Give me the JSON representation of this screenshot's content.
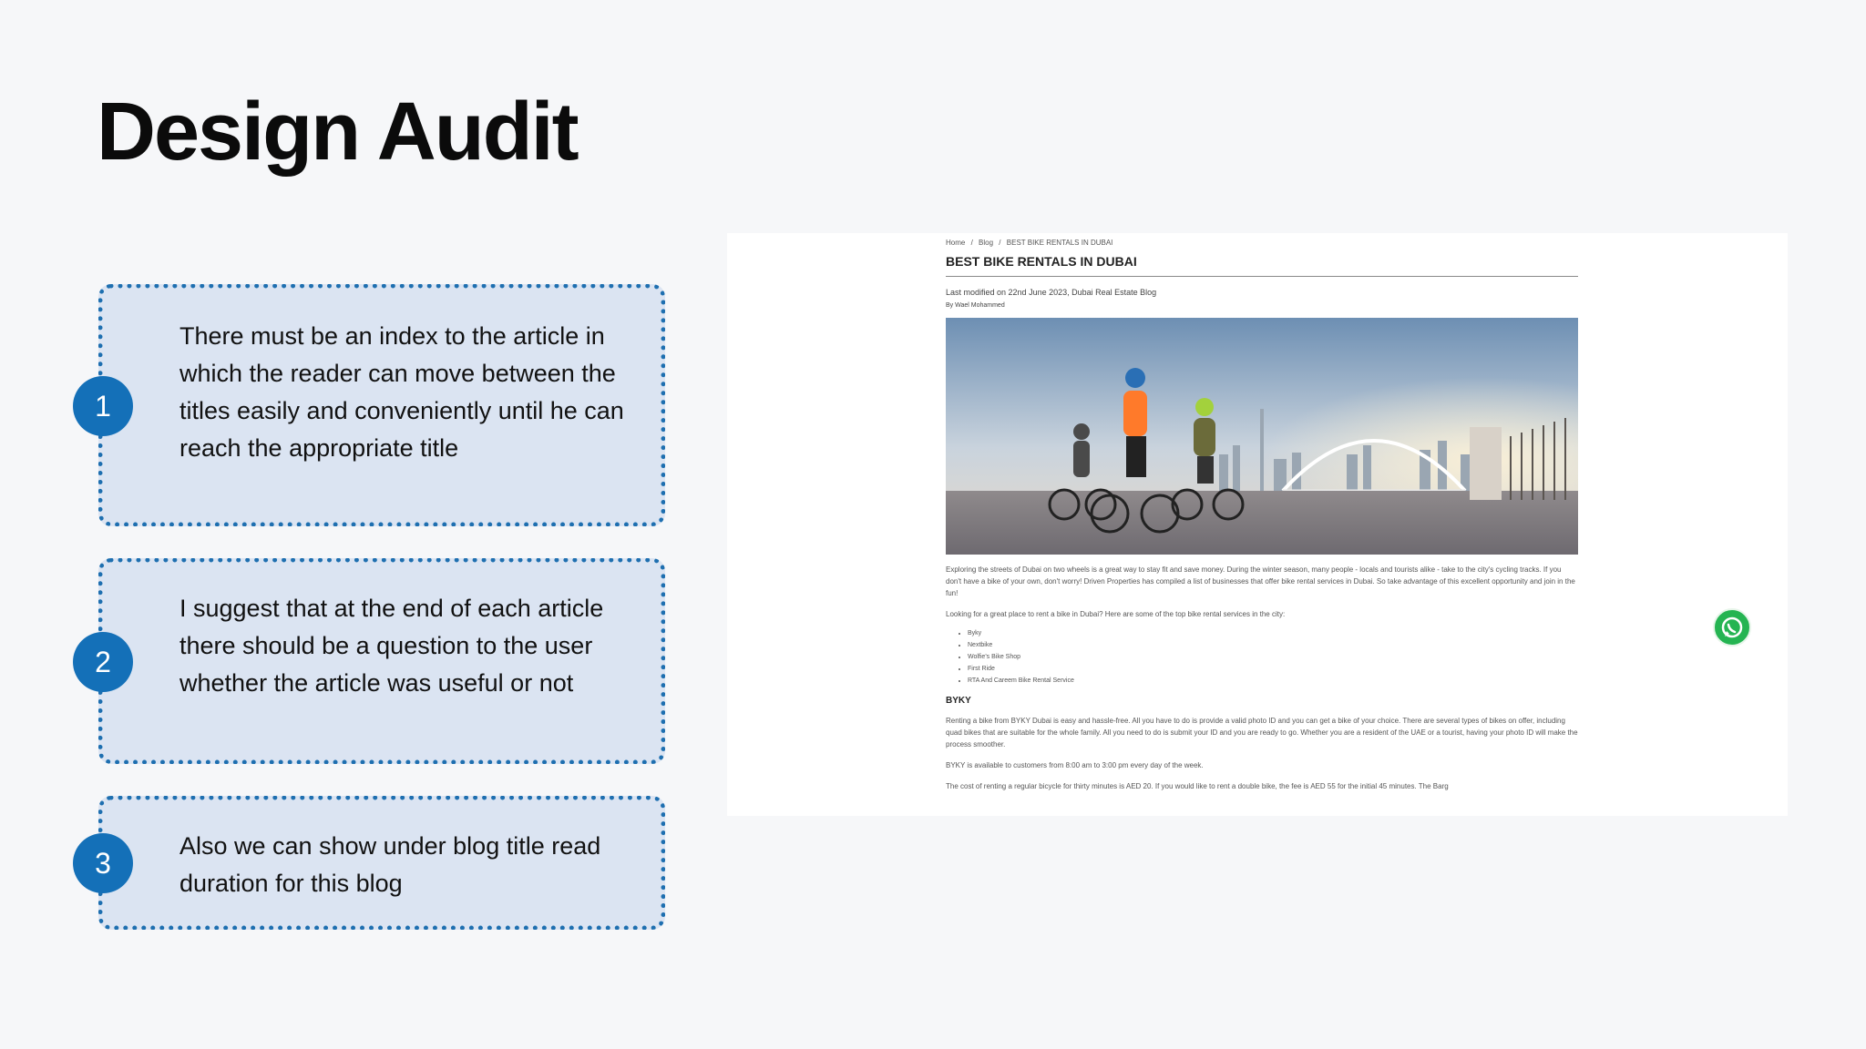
{
  "slide": {
    "title": "Design Audit"
  },
  "callouts": [
    {
      "number": "1",
      "text": "There must be an index to the article in which the reader can move between the titles easily and conveniently until he can reach the appropriate title"
    },
    {
      "number": "2",
      "text": "I suggest that at the end of each article there should be a question to the user whether the article was useful or not"
    },
    {
      "number": "3",
      "text": "Also we can show under blog title read duration for this blog"
    }
  ],
  "screenshot": {
    "breadcrumb": [
      "Home",
      "/",
      "Blog",
      "/",
      "BEST BIKE RENTALS IN DUBAI"
    ],
    "article_title": "BEST BIKE RENTALS IN DUBAI",
    "meta": "Last modified on 22nd June 2023, Dubai Real Estate Blog",
    "author": "By Wael Mohammed",
    "intro": "Exploring the streets of Dubai on two wheels is a great way to stay fit and save money. During the winter season, many people - locals and tourists alike - take to the city's cycling tracks. If you don't have a bike of your own, don't worry! Driven Properties has compiled a list of businesses that offer bike rental services in Dubai. So take advantage of this excellent opportunity and join in the fun!",
    "question": "Looking for a great place to rent a bike in Dubai? Here are some of the top bike rental services in the city:",
    "list": [
      "Byky",
      "Nextbike",
      "Wolfie's Bike Shop",
      "First Ride",
      "RTA And Careem Bike Rental Service"
    ],
    "section_heading": "BYKY",
    "byky_para": "Renting a bike from BYKY Dubai is easy and hassle-free. All you have to do is provide a valid photo ID and you can get a bike of your choice. There are several types of bikes on offer, including quad bikes that are suitable for the whole family. All you need to do is submit your ID and you are ready to go. Whether you are a resident of the UAE or a tourist, having your photo ID will make the process smoother.",
    "hours_para": "BYKY is available to customers from 8:00 am to 3:00 pm every day of the week.",
    "cost_para": "The cost of renting a regular bicycle for thirty minutes is AED 20. If you would like to rent a double bike, the fee is AED 55 for the initial 45 minutes. The Barg"
  }
}
